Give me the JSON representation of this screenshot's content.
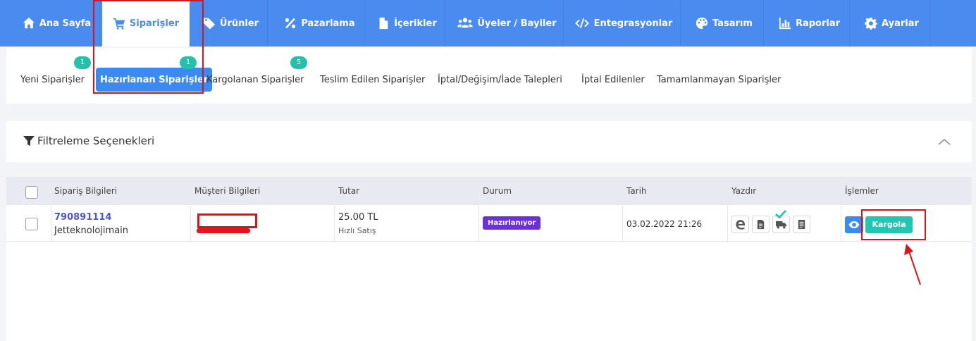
{
  "nav": {
    "items": [
      {
        "label": "Ana Sayfa",
        "icon": "home-icon"
      },
      {
        "label": "Siparişler",
        "icon": "cart-icon"
      },
      {
        "label": "Ürünler",
        "icon": "tag-icon"
      },
      {
        "label": "Pazarlama",
        "icon": "percent-icon"
      },
      {
        "label": "İçerikler",
        "icon": "document-icon"
      },
      {
        "label": "Üyeler / Bayiler",
        "icon": "users-icon"
      },
      {
        "label": "Entegrasyonlar",
        "icon": "code-icon"
      },
      {
        "label": "Tasarım",
        "icon": "palette-icon"
      },
      {
        "label": "Raporlar",
        "icon": "bar-chart-icon"
      },
      {
        "label": "Ayarlar",
        "icon": "gear-icon"
      }
    ],
    "active": "Siparişler"
  },
  "subtabs": [
    {
      "label": "Yeni Siparişler",
      "badge": "1"
    },
    {
      "label": "Hazırlanan Siparişler",
      "badge": "1"
    },
    {
      "label": "Kargolanan Siparişler",
      "badge": "5"
    },
    {
      "label": "Teslim Edilen Siparişler",
      "badge": null
    },
    {
      "label": "İptal/Değişim/İade Talepleri",
      "badge": null
    },
    {
      "label": "İptal Edilenler",
      "badge": null
    },
    {
      "label": "Tamamlanmayan Siparişler",
      "badge": null
    }
  ],
  "filter": {
    "title": "Filtreleme Seçenekleri"
  },
  "table": {
    "headers": [
      "Sipariş Bilgileri",
      "Müşteri Bilgileri",
      "Tutar",
      "Durum",
      "Tarih",
      "Yazdır",
      "İşlemler"
    ],
    "rows": [
      {
        "order_no": "790891114",
        "store": "Jetteknolojimain",
        "amount": "25.00 TL",
        "sale_type": "Hızlı Satış",
        "status": "Hazırlanıyor",
        "date": "03.02.2022 21:26",
        "print_icons": [
          "edge-icon",
          "invoice-icon",
          "truck-icon",
          "receipt-icon"
        ],
        "ship_label": "Kargola"
      }
    ]
  },
  "colors": {
    "nav_bg": "#4a8bef",
    "badge": "#21c2a9",
    "status": "#6b2fe0",
    "ship_button": "#21c7b0",
    "highlight": "#d9141b"
  }
}
